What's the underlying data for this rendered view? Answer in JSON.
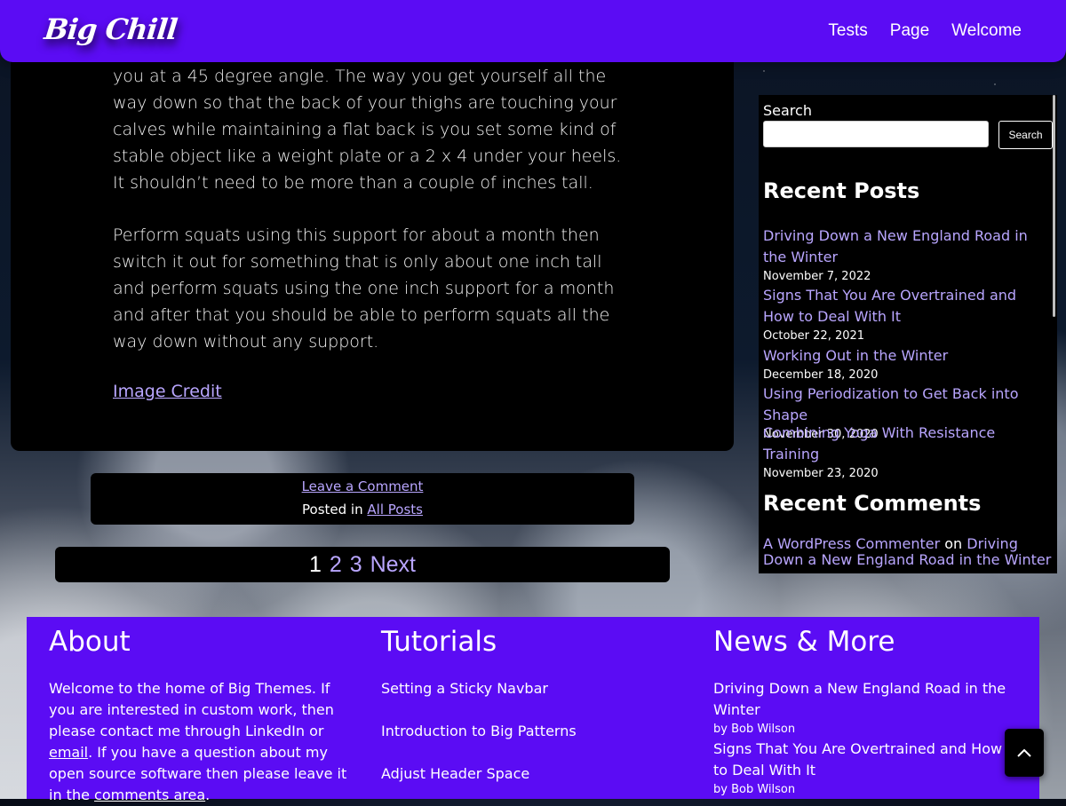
{
  "header": {
    "logo": "Big Chill",
    "nav": [
      "Tests",
      "Page",
      "Welcome"
    ]
  },
  "article": {
    "paragraph1": "you at a 45 degree angle. The way you get yourself all the way down so that the back of your thighs are touching your calves while maintaining a flat back is you set some kind of stable object like a weight plate or a 2 x 4 under your heels. It shouldn’t need to be more than a couple of inches tall.",
    "paragraph2": "Perform squats using this support for about a month then switch it out for something that is only about one inch tall and perform squats using the one inch support for a month and after that you should be able to perform squats all the way down without any support.",
    "credit": "Image Credit"
  },
  "meta": {
    "leave_comment": "Leave a Comment",
    "posted_in": "Posted in",
    "category": "All Posts"
  },
  "pagination": {
    "current": "1",
    "pages": [
      "2",
      "3"
    ],
    "next": "Next"
  },
  "sidebar": {
    "search_label": "Search",
    "search_placeholder": "",
    "search_button": "Search",
    "recent_posts_title": "Recent Posts",
    "recent_posts": [
      {
        "title": "Driving Down a New England Road in the Winter",
        "date": "November 7, 2022"
      },
      {
        "title": "Signs That You Are Overtrained and How to Deal With It",
        "date": "October 22, 2021"
      },
      {
        "title": "Working Out in the Winter",
        "date": "December 18, 2020"
      },
      {
        "title": "Using Periodization to Get Back into Shape",
        "date": "November 30, 2020"
      },
      {
        "title": "Combining Yoga With Resistance Training",
        "date": "November 23, 2020"
      }
    ],
    "recent_comments_title": "Recent Comments",
    "comment": {
      "author": "A WordPress Commenter",
      "on": "on",
      "post": "Driving Down a New England Road in the Winter"
    }
  },
  "footer": {
    "about": {
      "title": "About",
      "text_before": "Welcome to the home of Big Themes. If you are interested in custom work, then please contact me through LinkedIn or ",
      "email_link": "email",
      "text_middle": ". If you have a question about my open source software then please leave it in the ",
      "comments_link": "comments area",
      "text_after": "."
    },
    "tutorials": {
      "title": "Tutorials",
      "links": [
        "Setting a Sticky Navbar",
        "Introduction to Big Patterns",
        "Adjust Header Space"
      ]
    },
    "news": {
      "title": "News & More",
      "items": [
        {
          "title": "Driving Down a New England Road in the Winter",
          "byline": "by Bob Wilson"
        },
        {
          "title": "Signs That You Are Overtrained and How to Deal With It",
          "byline": "by Bob Wilson"
        }
      ]
    }
  },
  "colors": {
    "brand": "#5b0cf4",
    "link": "#b9a6ff",
    "panel": "#000000"
  },
  "icons": {
    "back_to_top": "chevron-up-icon"
  }
}
